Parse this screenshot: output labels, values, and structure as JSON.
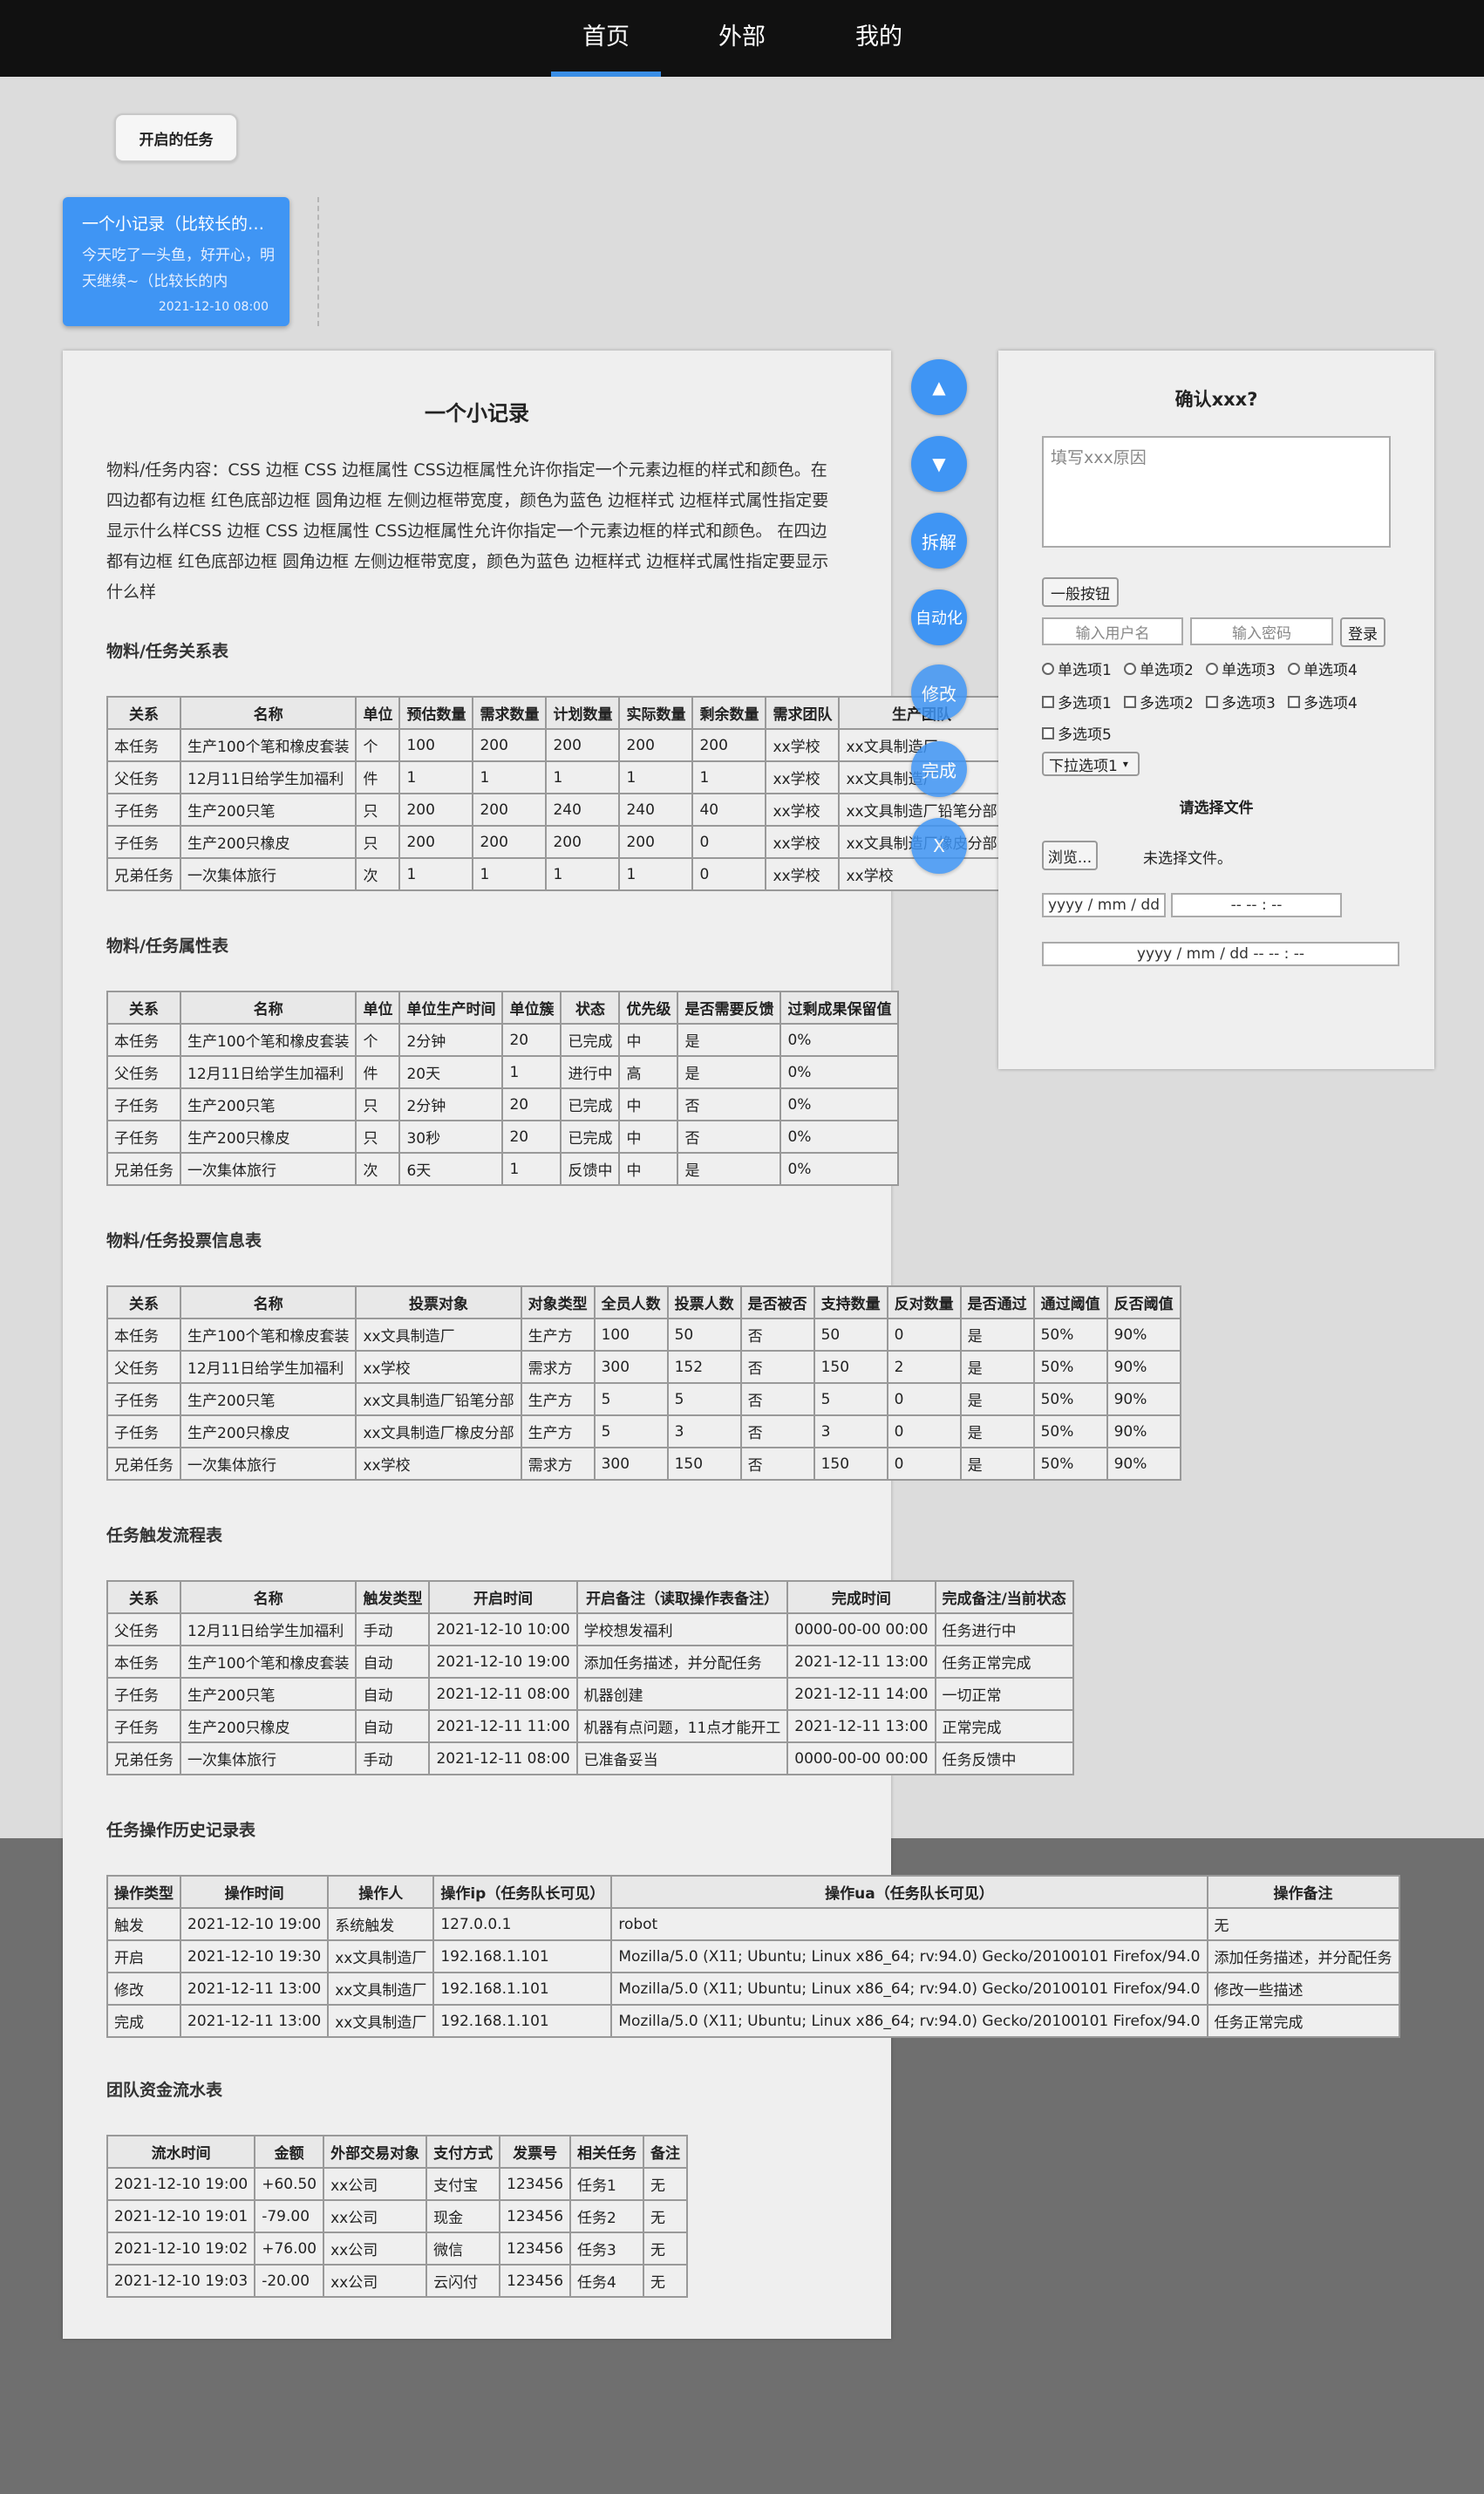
{
  "nav": {
    "tabs": [
      "首页",
      "外部",
      "我的"
    ],
    "active": "首页"
  },
  "open_tasks_label": "开启的任务",
  "card": {
    "title": "一个小记录（比较长的标题会被截断）",
    "body": "今天吃了一头鱼，好开心，明天继续~（比较长的内",
    "date": "2021-12-10 08:00"
  },
  "detail": {
    "title": "一个小记录",
    "desc": "物料/任务内容：CSS 边框 CSS 边框属性 CSS边框属性允许你指定一个元素边框的样式和颜色。在四边都有边框 红色底部边框 圆角边框 左侧边框带宽度，颜色为蓝色 边框样式 边框样式属性指定要显示什么样CSS 边框 CSS 边框属性 CSS边框属性允许你指定一个元素边框的样式和颜色。 在四边都有边框 红色底部边框 圆角边框 左侧边框带宽度，颜色为蓝色 边框样式 边框样式属性指定要显示什么样",
    "sections": [
      {
        "title": "物料/任务关系表",
        "headers": [
          "关系",
          "名称",
          "单位",
          "预估数量",
          "需求数量",
          "计划数量",
          "实际数量",
          "剩余数量",
          "需求团队",
          "生产团队"
        ],
        "rows": [
          [
            "本任务",
            "生产100个笔和橡皮套装",
            "个",
            "100",
            "200",
            "200",
            "200",
            "200",
            "xx学校",
            "xx文具制造厂"
          ],
          [
            "父任务",
            "12月11日给学生加福利",
            "件",
            "1",
            "1",
            "1",
            "1",
            "1",
            "xx学校",
            "xx文具制造厂"
          ],
          [
            "子任务",
            "生产200只笔",
            "只",
            "200",
            "200",
            "240",
            "240",
            "40",
            "xx学校",
            "xx文具制造厂铅笔分部"
          ],
          [
            "子任务",
            "生产200只橡皮",
            "只",
            "200",
            "200",
            "200",
            "200",
            "0",
            "xx学校",
            "xx文具制造厂橡皮分部"
          ],
          [
            "兄弟任务",
            "一次集体旅行",
            "次",
            "1",
            "1",
            "1",
            "1",
            "0",
            "xx学校",
            "xx学校"
          ]
        ]
      },
      {
        "title": "物料/任务属性表",
        "headers": [
          "关系",
          "名称",
          "单位",
          "单位生产时间",
          "单位簇",
          "状态",
          "优先级",
          "是否需要反馈",
          "过剩成果保留值"
        ],
        "rows": [
          [
            "本任务",
            "生产100个笔和橡皮套装",
            "个",
            "2分钟",
            "20",
            "已完成",
            "中",
            "是",
            "0%"
          ],
          [
            "父任务",
            "12月11日给学生加福利",
            "件",
            "20天",
            "1",
            "进行中",
            "高",
            "是",
            "0%"
          ],
          [
            "子任务",
            "生产200只笔",
            "只",
            "2分钟",
            "20",
            "已完成",
            "中",
            "否",
            "0%"
          ],
          [
            "子任务",
            "生产200只橡皮",
            "只",
            "30秒",
            "20",
            "已完成",
            "中",
            "否",
            "0%"
          ],
          [
            "兄弟任务",
            "一次集体旅行",
            "次",
            "6天",
            "1",
            "反馈中",
            "中",
            "是",
            "0%"
          ]
        ]
      },
      {
        "title": "物料/任务投票信息表",
        "headers": [
          "关系",
          "名称",
          "投票对象",
          "对象类型",
          "全员人数",
          "投票人数",
          "是否被否",
          "支持数量",
          "反对数量",
          "是否通过",
          "通过阈值",
          "反否阈值"
        ],
        "rows": [
          [
            "本任务",
            "生产100个笔和橡皮套装",
            "xx文具制造厂",
            "生产方",
            "100",
            "50",
            "否",
            "50",
            "0",
            "是",
            "50%",
            "90%"
          ],
          [
            "父任务",
            "12月11日给学生加福利",
            "xx学校",
            "需求方",
            "300",
            "152",
            "否",
            "150",
            "2",
            "是",
            "50%",
            "90%"
          ],
          [
            "子任务",
            "生产200只笔",
            "xx文具制造厂铅笔分部",
            "生产方",
            "5",
            "5",
            "否",
            "5",
            "0",
            "是",
            "50%",
            "90%"
          ],
          [
            "子任务",
            "生产200只橡皮",
            "xx文具制造厂橡皮分部",
            "生产方",
            "5",
            "3",
            "否",
            "3",
            "0",
            "是",
            "50%",
            "90%"
          ],
          [
            "兄弟任务",
            "一次集体旅行",
            "xx学校",
            "需求方",
            "300",
            "150",
            "否",
            "150",
            "0",
            "是",
            "50%",
            "90%"
          ]
        ]
      },
      {
        "title": "任务触发流程表",
        "headers": [
          "关系",
          "名称",
          "触发类型",
          "开启时间",
          "开启备注（读取操作表备注）",
          "完成时间",
          "完成备注/当前状态"
        ],
        "rows": [
          [
            "父任务",
            "12月11日给学生加福利",
            "手动",
            "2021-12-10 10:00",
            "学校想发福利",
            "0000-00-00 00:00",
            "任务进行中"
          ],
          [
            "本任务",
            "生产100个笔和橡皮套装",
            "自动",
            "2021-12-10 19:00",
            "添加任务描述，并分配任务",
            "2021-12-11 13:00",
            "任务正常完成"
          ],
          [
            "子任务",
            "生产200只笔",
            "自动",
            "2021-12-11 08:00",
            "机器创建",
            "2021-12-11 14:00",
            "一切正常"
          ],
          [
            "子任务",
            "生产200只橡皮",
            "自动",
            "2021-12-11 11:00",
            "机器有点问题，11点才能开工",
            "2021-12-11 13:00",
            "正常完成"
          ],
          [
            "兄弟任务",
            "一次集体旅行",
            "手动",
            "2021-12-11 08:00",
            "已准备妥当",
            "0000-00-00 00:00",
            "任务反馈中"
          ]
        ]
      },
      {
        "title": "任务操作历史记录表",
        "headers": [
          "操作类型",
          "操作时间",
          "操作人",
          "操作ip（任务队长可见）",
          "操作ua（任务队长可见）",
          "操作备注"
        ],
        "rows": [
          [
            "触发",
            "2021-12-10 19:00",
            "系统触发",
            "127.0.0.1",
            "robot",
            "无"
          ],
          [
            "开启",
            "2021-12-10 19:30",
            "xx文具制造厂",
            "192.168.1.101",
            "Mozilla/5.0 (X11; Ubuntu; Linux x86_64; rv:94.0) Gecko/20100101 Firefox/94.0",
            "添加任务描述，并分配任务"
          ],
          [
            "修改",
            "2021-12-11 13:00",
            "xx文具制造厂",
            "192.168.1.101",
            "Mozilla/5.0 (X11; Ubuntu; Linux x86_64; rv:94.0) Gecko/20100101 Firefox/94.0",
            "修改一些描述"
          ],
          [
            "完成",
            "2021-12-11 13:00",
            "xx文具制造厂",
            "192.168.1.101",
            "Mozilla/5.0 (X11; Ubuntu; Linux x86_64; rv:94.0) Gecko/20100101 Firefox/94.0",
            "任务正常完成"
          ]
        ]
      },
      {
        "title": "团队资金流水表",
        "headers": [
          "流水时间",
          "金额",
          "外部交易对象",
          "支付方式",
          "发票号",
          "相关任务",
          "备注"
        ],
        "rows": [
          [
            "2021-12-10 19:00",
            "+60.50",
            "xx公司",
            "支付宝",
            "123456",
            "任务1",
            "无"
          ],
          [
            "2021-12-10 19:01",
            "-79.00",
            "xx公司",
            "现金",
            "123456",
            "任务2",
            "无"
          ],
          [
            "2021-12-10 19:02",
            "+76.00",
            "xx公司",
            "微信",
            "123456",
            "任务3",
            "无"
          ],
          [
            "2021-12-10 19:03",
            "-20.00",
            "xx公司",
            "云闪付",
            "123456",
            "任务4",
            "无"
          ]
        ]
      }
    ]
  },
  "float_buttons": [
    "▲",
    "▼",
    "拆解",
    "自动化",
    "修改",
    "完成",
    "X"
  ],
  "confirm": {
    "title": "确认xxx?",
    "reason_placeholder": "填写xxx原因",
    "normal_button": "一般按钮",
    "username_placeholder": "输入用户名",
    "password_placeholder": "输入密码",
    "login_button": "登录",
    "radios": [
      "单选项1",
      "单选项2",
      "单选项3",
      "单选项4"
    ],
    "checks": [
      "多选项1",
      "多选项2",
      "多选项3",
      "多选项4",
      "多选项5"
    ],
    "select_value": "下拉选项1",
    "file_title": "请选择文件",
    "browse_button": "浏览...",
    "no_file": "未选择文件。",
    "date_placeholder": "yyyy / mm / dd",
    "time_placeholder": "-- -- : --",
    "datetime_placeholder": "yyyy / mm / dd  -- -- : --"
  },
  "colors": {
    "accent": "#3f95f4",
    "nav_bg": "#111111"
  }
}
